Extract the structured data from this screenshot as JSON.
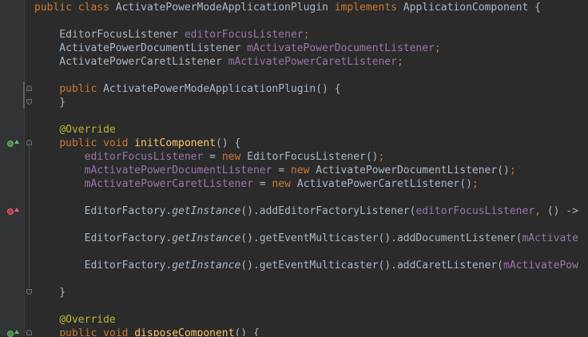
{
  "editor": {
    "lines": [
      [
        {
          "t": "public ",
          "c": "kw"
        },
        {
          "t": "class ",
          "c": "kw"
        },
        {
          "t": "ActivatePowerModeApplicationPlugin ",
          "c": "plain"
        },
        {
          "t": "implements ",
          "c": "kw"
        },
        {
          "t": "ApplicationComponent {",
          "c": "plain"
        }
      ],
      [],
      [
        {
          "t": "    EditorFocusListener ",
          "c": "plain"
        },
        {
          "t": "editorFocusListener",
          "c": "field"
        },
        {
          "t": ";",
          "c": "kw"
        }
      ],
      [
        {
          "t": "    ActivatePowerDocumentListener ",
          "c": "plain"
        },
        {
          "t": "mActivatePowerDocumentListener",
          "c": "field"
        },
        {
          "t": ";",
          "c": "kw"
        }
      ],
      [
        {
          "t": "    ActivatePowerCaretListener ",
          "c": "plain"
        },
        {
          "t": "mActivatePowerCaretListener",
          "c": "field"
        },
        {
          "t": ";",
          "c": "kw"
        }
      ],
      [],
      [
        {
          "t": "    ",
          "c": "plain"
        },
        {
          "t": "public ",
          "c": "kw"
        },
        {
          "t": "ActivatePowerModeApplicationPlugin() {",
          "c": "plain"
        }
      ],
      [
        {
          "t": "    }",
          "c": "plain"
        }
      ],
      [],
      [
        {
          "t": "    ",
          "c": "plain"
        },
        {
          "t": "@Override",
          "c": "ann"
        }
      ],
      [
        {
          "t": "    ",
          "c": "plain"
        },
        {
          "t": "public void ",
          "c": "kw"
        },
        {
          "t": "initComponent",
          "c": "fn"
        },
        {
          "t": "() {",
          "c": "plain"
        }
      ],
      [
        {
          "t": "        ",
          "c": "plain"
        },
        {
          "t": "editorFocusListener",
          "c": "field"
        },
        {
          "t": " = ",
          "c": "plain"
        },
        {
          "t": "new ",
          "c": "kw"
        },
        {
          "t": "EditorFocusListener()",
          "c": "plain"
        },
        {
          "t": ";",
          "c": "kw"
        }
      ],
      [
        {
          "t": "        ",
          "c": "plain"
        },
        {
          "t": "mActivatePowerDocumentListener",
          "c": "field"
        },
        {
          "t": " = ",
          "c": "plain"
        },
        {
          "t": "new ",
          "c": "kw"
        },
        {
          "t": "ActivatePowerDocumentListener()",
          "c": "plain"
        },
        {
          "t": ";",
          "c": "kw"
        }
      ],
      [
        {
          "t": "        ",
          "c": "plain"
        },
        {
          "t": "mActivatePowerCaretListener",
          "c": "field"
        },
        {
          "t": " = ",
          "c": "plain"
        },
        {
          "t": "new ",
          "c": "kw"
        },
        {
          "t": "ActivatePowerCaretListener()",
          "c": "plain"
        },
        {
          "t": ";",
          "c": "kw"
        }
      ],
      [],
      [
        {
          "t": "        EditorFactory.",
          "c": "plain"
        },
        {
          "t": "getInstance",
          "c": "italic"
        },
        {
          "t": "().addEditorFactoryListener(",
          "c": "plain"
        },
        {
          "t": "editorFocusListener",
          "c": "field"
        },
        {
          "t": ", ",
          "c": "kw"
        },
        {
          "t": "() ->",
          "c": "plain"
        }
      ],
      [],
      [
        {
          "t": "        EditorFactory.",
          "c": "plain"
        },
        {
          "t": "getInstance",
          "c": "italic"
        },
        {
          "t": "().getEventMulticaster().addDocumentListener(",
          "c": "plain"
        },
        {
          "t": "mActivate",
          "c": "field"
        }
      ],
      [],
      [
        {
          "t": "        EditorFactory.",
          "c": "plain"
        },
        {
          "t": "getInstance",
          "c": "italic"
        },
        {
          "t": "().getEventMulticaster().addCaretListener(",
          "c": "plain"
        },
        {
          "t": "mActivatePow",
          "c": "field"
        }
      ],
      [],
      [
        {
          "t": "    }",
          "c": "plain"
        }
      ],
      [],
      [
        {
          "t": "    ",
          "c": "plain"
        },
        {
          "t": "@Override",
          "c": "ann"
        }
      ],
      [
        {
          "t": "    ",
          "c": "plain"
        },
        {
          "t": "public void ",
          "c": "kw"
        },
        {
          "t": "disposeComponent",
          "c": "fn"
        },
        {
          "t": "() {",
          "c": "plain"
        }
      ]
    ]
  },
  "gutter": {
    "markers": [
      {
        "type": "implements",
        "icon": "implementing-method-icon",
        "line": 10
      },
      {
        "type": "overrides",
        "icon": "overriding-method-icon",
        "line": 15
      },
      {
        "type": "implements",
        "icon": "implementing-method-icon",
        "line": 24
      }
    ]
  },
  "colors": {
    "background": "#2b2b2b",
    "keyword": "#cc7832",
    "field": "#9876aa",
    "annotation": "#bbb529",
    "function": "#ffc66d",
    "text": "#a9b7c6"
  }
}
